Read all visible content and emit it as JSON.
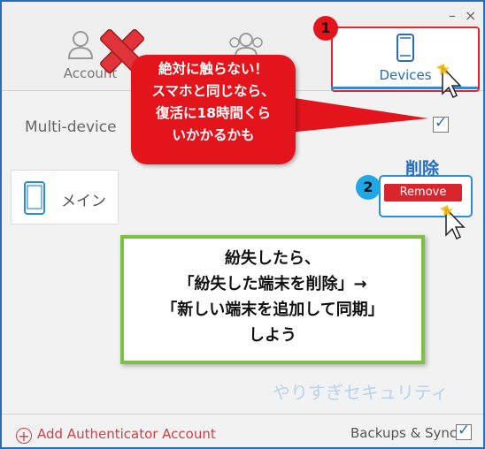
{
  "window": {
    "minimize": "–",
    "close": "×"
  },
  "tabs": [
    {
      "label": "Account",
      "icon": "person-icon"
    },
    {
      "label": "",
      "icon": "people-icon"
    },
    {
      "label": "Devices",
      "icon": "smartphone-icon"
    }
  ],
  "multi_device": {
    "label": "Multi-device",
    "checked": true
  },
  "device": {
    "name": "メイン",
    "icon": "smartphone-icon"
  },
  "remove_button": {
    "label": "Remove"
  },
  "annotations": {
    "step1": "1",
    "step2": "2",
    "delete_label": "削除",
    "red_callout": [
      "絶対に触らない！",
      "スマホと同じなら、",
      "復活に18時間くら",
      "いかかるかも"
    ],
    "green_callout": [
      "紛失したら、",
      "「紛失した端末を削除」→",
      "「新しい端末を追加して同期」",
      "しよう"
    ],
    "watermark": "やりすぎセキュリティ"
  },
  "footer": {
    "add_account": "Add Authenticator Account",
    "backups": "Backups & Sync",
    "backups_checked": true
  },
  "colors": {
    "accent": "#2a6db5",
    "red": "#e3141c",
    "green": "#7cc242"
  }
}
